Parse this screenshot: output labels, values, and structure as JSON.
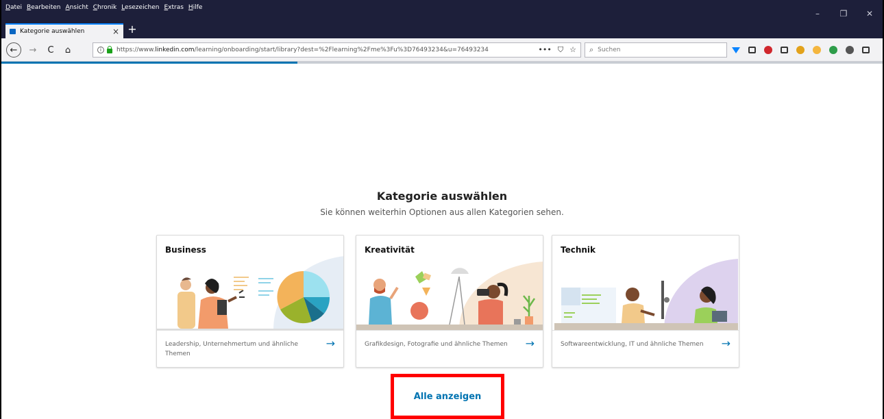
{
  "menubar": [
    "Datei",
    "Bearbeiten",
    "Ansicht",
    "Chronik",
    "Lesezeichen",
    "Extras",
    "Hilfe"
  ],
  "tab": {
    "title": "Kategorie auswählen",
    "close": "×",
    "new": "+"
  },
  "window_controls": {
    "minimize": "–",
    "restore": "❐",
    "close": "✕"
  },
  "nav": {
    "back": "←",
    "forward": "→",
    "reload": "C",
    "home": "⌂"
  },
  "urlbar": {
    "info": "i",
    "prefix": "https://www.",
    "host": "linkedin.com",
    "path": "/learning/onboarding/start/library?dest=%2Flearning%2Fme%3Fu%3D76493234&u=76493234",
    "page_actions": "•••",
    "pocket": "⛉",
    "bookmark": "☆"
  },
  "search": {
    "icon": "⌕",
    "placeholder": "Suchen"
  },
  "toolbar_icons": [
    "download-icon",
    "library-icon",
    "adblock-icon",
    "sidebar-icon",
    "extension-icon",
    "extension-icon",
    "extension-icon",
    "extension-icon",
    "menu-icon"
  ],
  "toolbar_colors": [
    "#0a84ff",
    "#333333",
    "#d0272d",
    "#333333",
    "#e2a21b",
    "#f4b63f",
    "#2e9d4a",
    "#555555",
    "#333333"
  ],
  "progress_fraction": 0.336,
  "page": {
    "heading": "Kategorie auswählen",
    "subheading": "Sie können weiterhin Optionen aus allen Kategorien sehen.",
    "show_all": "Alle anzeigen"
  },
  "cards": [
    {
      "title": "Business",
      "description": "Leadership, Unternehmertum und ähnliche Themen",
      "arrow": "→"
    },
    {
      "title": "Kreativität",
      "description": "Grafikdesign, Fotografie und ähnliche Themen",
      "arrow": "→"
    },
    {
      "title": "Technik",
      "description": "Softwareentwicklung, IT und ähnliche Themen",
      "arrow": "→"
    }
  ],
  "colors": {
    "accent": "#0073b1",
    "highlight_box": "#ff0000",
    "titlebar": "#1d1f3a"
  }
}
